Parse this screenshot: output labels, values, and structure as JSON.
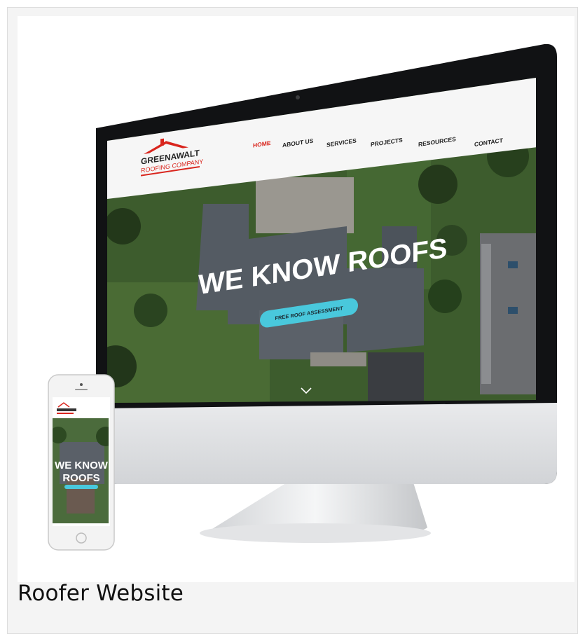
{
  "caption": "Roofer Website",
  "website": {
    "logo_main": "GREENAWALT",
    "logo_sub": "ROOFING COMPANY",
    "nav": [
      "HOME",
      "ABOUT US",
      "SERVICES",
      "PROJECTS",
      "RESOURCES",
      "CONTACT"
    ],
    "active_nav": "HOME",
    "hero_title": "WE KNOW ROOFS",
    "cta_label": "FREE ROOF ASSESSMENT",
    "scroll_icon": "chevron-down-icon"
  },
  "phone": {
    "hero_line1": "WE KNOW",
    "hero_line2": "ROOFS"
  },
  "colors": {
    "brand_red": "#d9251d",
    "cta_cyan": "#49c8dc",
    "grass": "#3d5c2d",
    "roof": "#545b63"
  }
}
